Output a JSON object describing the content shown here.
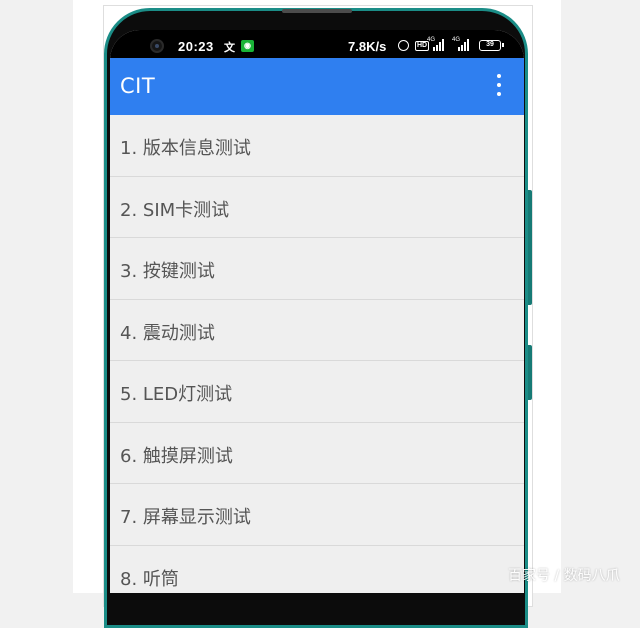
{
  "status_bar": {
    "time": "20:23",
    "net_speed": "7.8K/s",
    "battery": "39",
    "network_labels": [
      "4G",
      "4G"
    ],
    "hd_label": "HD",
    "wechat_icon": "wechat-icon",
    "translate_glyph": "文"
  },
  "app_bar": {
    "title": "CIT",
    "menu_icon": "overflow-menu-icon"
  },
  "list": {
    "items": [
      "1. 版本信息测试",
      "2. SIM卡测试",
      "3. 按键测试",
      "4. 震动测试",
      "5. LED灯测试",
      "6. 触摸屏测试",
      "7. 屏幕显示测试",
      "8. 听筒"
    ]
  },
  "watermark": "百家号 / 数码八爪",
  "colors": {
    "app_bar": "#2f7ff0",
    "phone_frame": "#1b8d87",
    "list_background": "#efefef",
    "list_text": "#555555"
  }
}
